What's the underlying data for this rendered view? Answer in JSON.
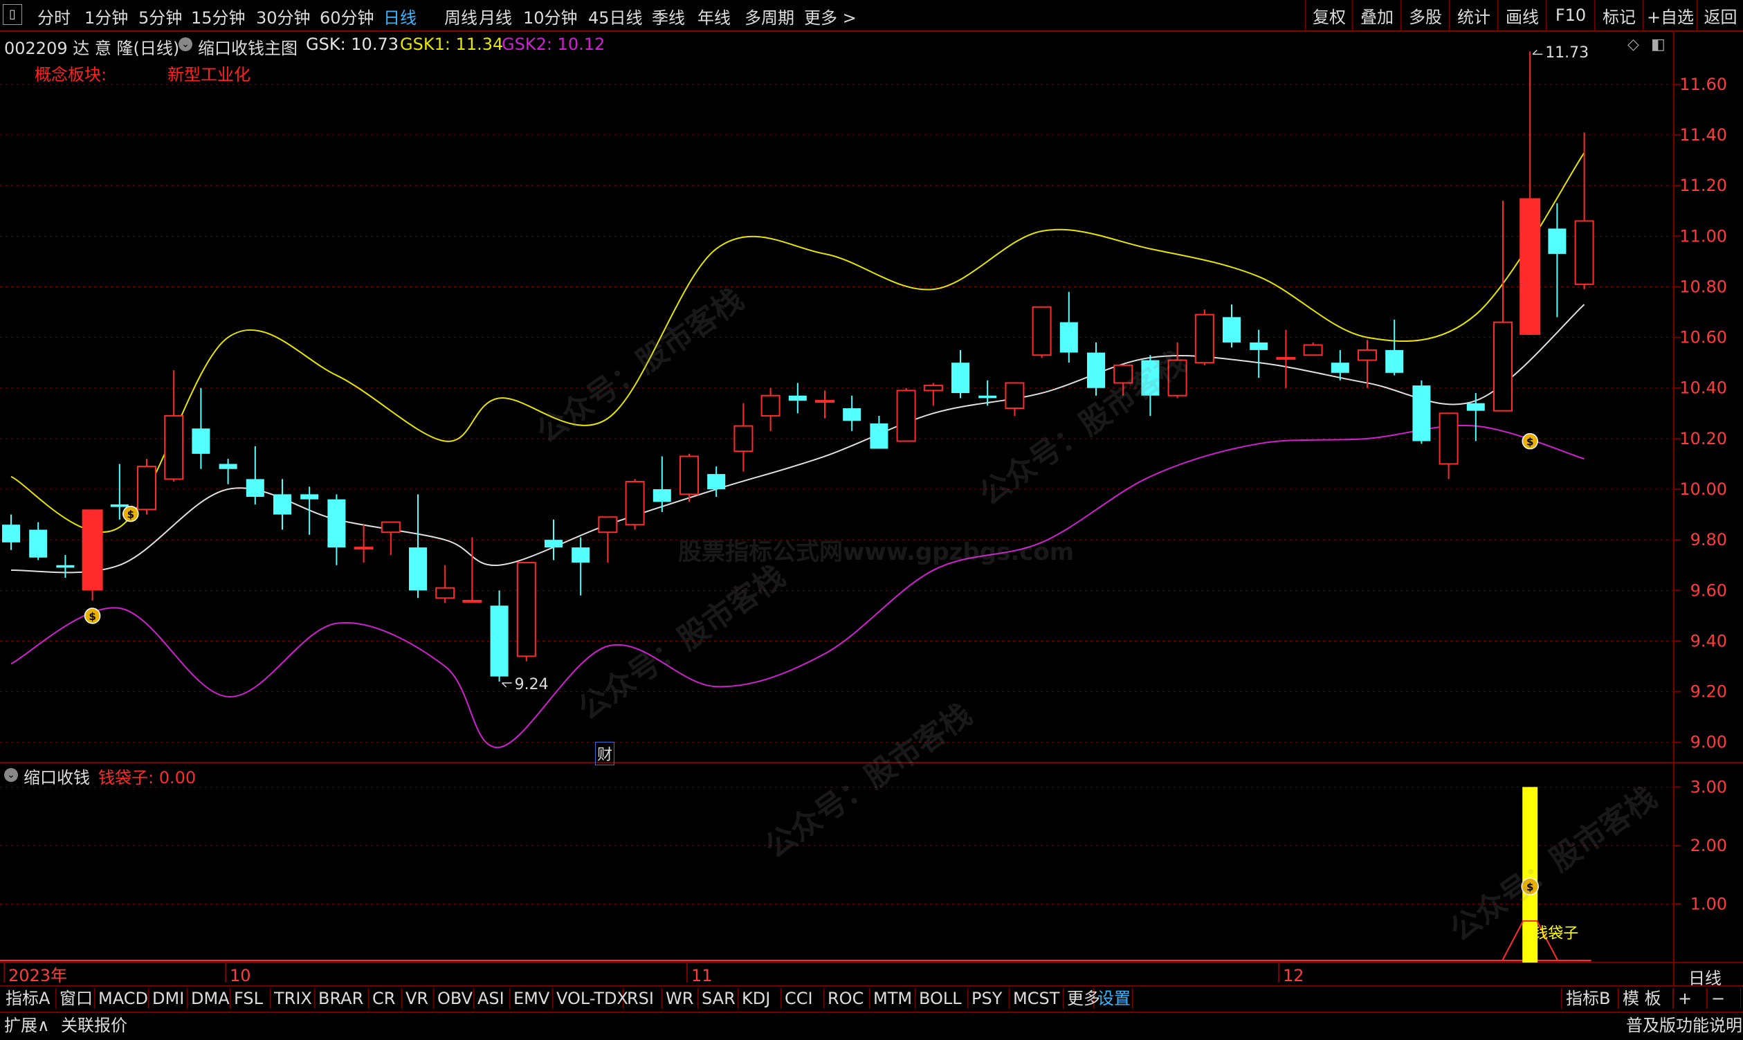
{
  "toolbar": {
    "left_items": [
      "分时",
      "1分钟",
      "5分钟",
      "15分钟",
      "30分钟",
      "60分钟",
      "日线",
      "周线",
      "月线",
      "10分钟",
      "45日线",
      "季线",
      "年线",
      "多周期",
      "更多 >"
    ],
    "active": "日线",
    "right_items": [
      "复权",
      "叠加",
      "多股",
      "统计",
      "画线",
      "F10",
      "标记",
      "+自选",
      "返回"
    ]
  },
  "stock": {
    "code_name": "002209 达 意 隆(日线)",
    "indicator_title": "缩口收钱主图",
    "gsk": "GSK: 10.73",
    "gsk1": "GSK1: 11.34",
    "gsk2": "GSK2: 10.12",
    "concept_label": "概念板块:",
    "concept_value": "新型工业化"
  },
  "colors": {
    "up": "#ff2a2a",
    "down": "#54ffff",
    "upper_band": "#e6e600",
    "lower_band": "#d020d0",
    "mid_line": "#e0e0e0",
    "grid": "#7a0000",
    "axis_text": "#ff3b3b",
    "volume_bar": "#ffff00"
  },
  "main_chart": {
    "y_ticks": [
      "11.60",
      "11.40",
      "11.20",
      "11.00",
      "10.80",
      "10.60",
      "10.40",
      "10.20",
      "10.00",
      "9.80",
      "9.60",
      "9.40",
      "9.20",
      "9.00"
    ],
    "high_marker": "11.73",
    "low_marker": "9.24",
    "finance_badge": "财"
  },
  "sub_chart": {
    "title": "缩口收钱",
    "series_label": "钱袋子: 0.00",
    "y_ticks": [
      "3.00",
      "2.00",
      "1.00"
    ],
    "marker_text": "钱袋子"
  },
  "x_axis": {
    "labels": [
      "2023年",
      "10",
      "11",
      "12"
    ],
    "period": "日线"
  },
  "chart_data": {
    "type": "candlestick",
    "candles": [
      {
        "o": 9.86,
        "h": 9.9,
        "c": 9.79,
        "l": 9.76
      },
      {
        "o": 9.84,
        "h": 9.87,
        "c": 9.73,
        "l": 9.72
      },
      {
        "o": 9.7,
        "h": 9.74,
        "c": 9.69,
        "l": 9.65
      },
      {
        "o": 9.6,
        "h": 9.92,
        "c": 9.92,
        "l": 9.56
      },
      {
        "o": 9.94,
        "h": 10.1,
        "c": 9.93,
        "l": 9.88
      },
      {
        "o": 9.92,
        "h": 10.12,
        "c": 10.09,
        "l": 9.9
      },
      {
        "o": 10.04,
        "h": 10.47,
        "c": 10.29,
        "l": 10.03
      },
      {
        "o": 10.24,
        "h": 10.4,
        "c": 10.14,
        "l": 10.08
      },
      {
        "o": 10.1,
        "h": 10.12,
        "c": 10.08,
        "l": 10.02
      },
      {
        "o": 10.04,
        "h": 10.17,
        "c": 9.97,
        "l": 9.94
      },
      {
        "o": 9.98,
        "h": 10.04,
        "c": 9.9,
        "l": 9.84
      },
      {
        "o": 9.98,
        "h": 10.01,
        "c": 9.96,
        "l": 9.82
      },
      {
        "o": 9.96,
        "h": 9.98,
        "c": 9.77,
        "l": 9.7
      },
      {
        "o": 9.77,
        "h": 9.86,
        "c": 9.77,
        "l": 9.71
      },
      {
        "o": 9.83,
        "h": 9.87,
        "c": 9.87,
        "l": 9.74
      },
      {
        "o": 9.77,
        "h": 9.98,
        "c": 9.6,
        "l": 9.57
      },
      {
        "o": 9.57,
        "h": 9.7,
        "c": 9.61,
        "l": 9.55
      },
      {
        "o": 9.56,
        "h": 9.81,
        "c": 9.56,
        "l": 9.56
      },
      {
        "o": 9.54,
        "h": 9.6,
        "c": 9.26,
        "l": 9.24
      },
      {
        "o": 9.34,
        "h": 9.71,
        "c": 9.71,
        "l": 9.32
      },
      {
        "o": 9.8,
        "h": 9.88,
        "c": 9.77,
        "l": 9.72
      },
      {
        "o": 9.77,
        "h": 9.81,
        "c": 9.71,
        "l": 9.58
      },
      {
        "o": 9.83,
        "h": 9.87,
        "c": 9.89,
        "l": 9.71
      },
      {
        "o": 9.86,
        "h": 10.04,
        "c": 10.03,
        "l": 9.84
      },
      {
        "o": 10.0,
        "h": 10.13,
        "c": 9.95,
        "l": 9.91
      },
      {
        "o": 9.98,
        "h": 10.14,
        "c": 10.13,
        "l": 9.95
      },
      {
        "o": 10.06,
        "h": 10.09,
        "c": 10.0,
        "l": 9.97
      },
      {
        "o": 10.15,
        "h": 10.34,
        "c": 10.25,
        "l": 10.07
      },
      {
        "o": 10.29,
        "h": 10.4,
        "c": 10.37,
        "l": 10.23
      },
      {
        "o": 10.37,
        "h": 10.42,
        "c": 10.35,
        "l": 10.3
      },
      {
        "o": 10.35,
        "h": 10.39,
        "c": 10.35,
        "l": 10.28
      },
      {
        "o": 10.32,
        "h": 10.37,
        "c": 10.27,
        "l": 10.23
      },
      {
        "o": 10.26,
        "h": 10.29,
        "c": 10.16,
        "l": 10.16
      },
      {
        "o": 10.19,
        "h": 10.4,
        "c": 10.39,
        "l": 10.19
      },
      {
        "o": 10.39,
        "h": 10.42,
        "c": 10.41,
        "l": 10.33
      },
      {
        "o": 10.5,
        "h": 10.55,
        "c": 10.38,
        "l": 10.36
      },
      {
        "o": 10.37,
        "h": 10.43,
        "c": 10.36,
        "l": 10.33
      },
      {
        "o": 10.32,
        "h": 10.42,
        "c": 10.42,
        "l": 10.29
      },
      {
        "o": 10.53,
        "h": 10.72,
        "c": 10.72,
        "l": 10.52
      },
      {
        "o": 10.66,
        "h": 10.78,
        "c": 10.54,
        "l": 10.5
      },
      {
        "o": 10.54,
        "h": 10.58,
        "c": 10.4,
        "l": 10.37
      },
      {
        "o": 10.42,
        "h": 10.49,
        "c": 10.49,
        "l": 10.37
      },
      {
        "o": 10.51,
        "h": 10.53,
        "c": 10.37,
        "l": 10.29
      },
      {
        "o": 10.37,
        "h": 10.58,
        "c": 10.51,
        "l": 10.36
      },
      {
        "o": 10.5,
        "h": 10.71,
        "c": 10.69,
        "l": 10.49
      },
      {
        "o": 10.68,
        "h": 10.73,
        "c": 10.58,
        "l": 10.56
      },
      {
        "o": 10.58,
        "h": 10.63,
        "c": 10.55,
        "l": 10.44
      },
      {
        "o": 10.52,
        "h": 10.63,
        "c": 10.52,
        "l": 10.4
      },
      {
        "o": 10.53,
        "h": 10.58,
        "c": 10.57,
        "l": 10.53
      },
      {
        "o": 10.5,
        "h": 10.55,
        "c": 10.46,
        "l": 10.43
      },
      {
        "o": 10.51,
        "h": 10.59,
        "c": 10.55,
        "l": 10.4
      },
      {
        "o": 10.55,
        "h": 10.67,
        "c": 10.46,
        "l": 10.45
      },
      {
        "o": 10.41,
        "h": 10.43,
        "c": 10.19,
        "l": 10.18
      },
      {
        "o": 10.1,
        "h": 10.29,
        "c": 10.3,
        "l": 10.04
      },
      {
        "o": 10.34,
        "h": 10.38,
        "c": 10.31,
        "l": 10.19
      },
      {
        "o": 10.31,
        "h": 11.14,
        "c": 10.66,
        "l": 10.31
      },
      {
        "o": 10.61,
        "h": 11.73,
        "c": 11.15,
        "l": 10.61
      },
      {
        "o": 11.03,
        "h": 11.13,
        "c": 10.93,
        "l": 10.68
      },
      {
        "o": 10.81,
        "h": 11.41,
        "c": 11.06,
        "l": 10.79
      }
    ],
    "bands_x": [
      0,
      4,
      8,
      12,
      16,
      18,
      22,
      26,
      30,
      34,
      38,
      42,
      46,
      50,
      54,
      58
    ],
    "upper": [
      10.05,
      9.85,
      10.6,
      10.45,
      10.19,
      10.36,
      10.28,
      10.95,
      10.93,
      10.79,
      11.02,
      10.95,
      10.84,
      10.6,
      10.69,
      11.33
    ],
    "mid": [
      9.68,
      9.7,
      10.0,
      9.88,
      9.8,
      9.7,
      9.86,
      10.0,
      10.13,
      10.3,
      10.38,
      10.52,
      10.5,
      10.42,
      10.35,
      10.73
    ],
    "lower": [
      9.31,
      9.53,
      9.18,
      9.47,
      9.3,
      8.98,
      9.38,
      9.22,
      9.35,
      9.68,
      9.79,
      10.05,
      10.18,
      10.2,
      10.25,
      10.12
    ],
    "signal_candles": [
      3,
      56
    ],
    "sub_series": {
      "name": "钱袋子",
      "bar_index": 56,
      "bar_value": 3.0,
      "current": 0.0,
      "y_range": [
        0,
        3.3
      ]
    },
    "y_range": [
      8.92,
      11.72
    ]
  }
}
